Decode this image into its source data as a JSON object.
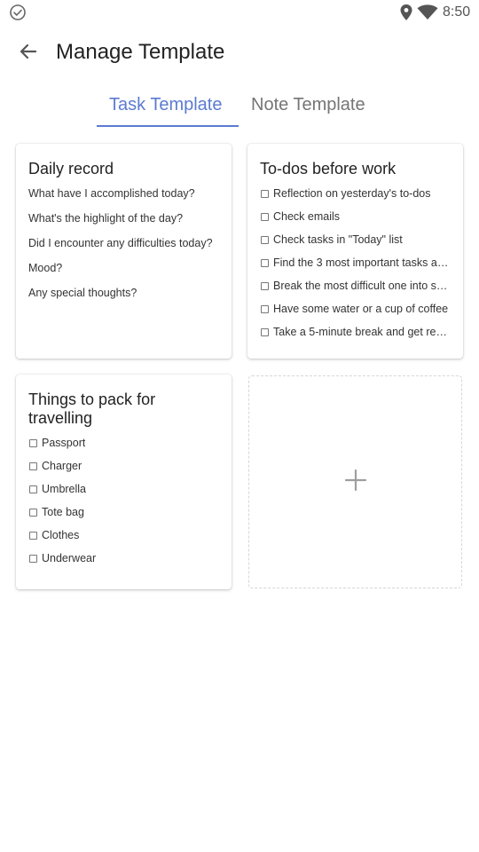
{
  "status_bar": {
    "time": "8:50",
    "icons": [
      "check-circle-icon",
      "location-pin-icon",
      "wifi-icon"
    ]
  },
  "app_bar": {
    "title": "Manage Template",
    "back_icon": "arrow-left-icon"
  },
  "tabs": [
    {
      "label": "Task Template",
      "active": true
    },
    {
      "label": "Note Template",
      "active": false
    }
  ],
  "accent_color": "#5b7bd0",
  "templates": [
    {
      "title": "Daily record",
      "type": "text",
      "lines": [
        "What have I accomplished today?",
        "What's the highlight of the day?",
        "Did I encounter any difficulties today?",
        "Mood?",
        "Any special thoughts?"
      ]
    },
    {
      "title": "To-dos before work",
      "type": "checklist",
      "lines": [
        "Reflection on yesterday's to-dos",
        "Check emails",
        "Check tasks in \"Today\" list",
        "Find the 3 most important tasks an…",
        "Break the most difficult one into sm…",
        "Have some water or a cup of coffee",
        "Take a 5-minute break and get read…"
      ]
    },
    {
      "title": "Things to pack for travelling",
      "type": "checklist",
      "lines": [
        "Passport",
        "Charger",
        "Umbrella",
        "Tote bag",
        "Clothes",
        "Underwear"
      ]
    }
  ],
  "add_template": {
    "icon": "plus-icon"
  }
}
